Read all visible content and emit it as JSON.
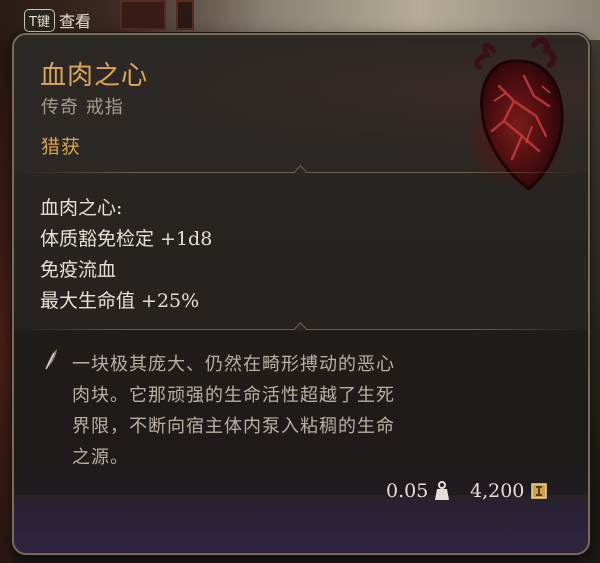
{
  "hotkey": {
    "key": "T键",
    "label": "查看"
  },
  "item": {
    "name": "血肉之心",
    "type": "传奇 戒指",
    "source": "猎获",
    "icon": "bleeding-heart-icon"
  },
  "stats": {
    "header": "血肉之心:",
    "lines": [
      "体质豁免检定 +1d8",
      "免疫流血",
      "最大生命值 +25%"
    ]
  },
  "description": {
    "icon": "quill-icon",
    "text": "一块极其庞大、仍然在畸形搏动的恶心肉块。它那顽强的生命活性超越了生死界限，不断向宿主体内泵入粘稠的生命之源。"
  },
  "footer": {
    "weight": "0.05",
    "weight_icon": "weight-icon",
    "price": "4,200",
    "price_icon": "gold-coin-icon"
  },
  "colors": {
    "name": "#e0a55a",
    "rarity": "#a59c8e",
    "source": "#d9a44a"
  }
}
